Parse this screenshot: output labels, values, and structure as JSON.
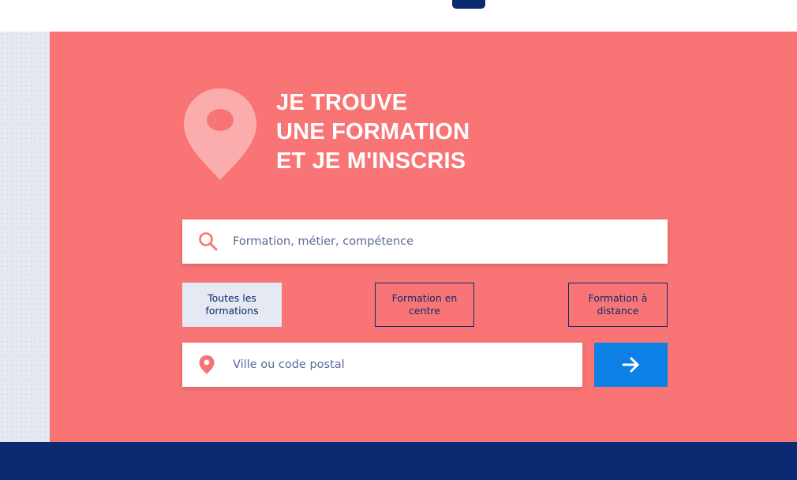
{
  "headline": {
    "line1": "JE TROUVE",
    "line2": "UNE FORMATION",
    "line3": "ET JE M'INSCRIS"
  },
  "search": {
    "placeholder": "Formation, métier, compétence",
    "value": "",
    "icon": "search-icon"
  },
  "filters": [
    {
      "label": "Toutes les formations",
      "active": true
    },
    {
      "label": "Formation en centre",
      "active": false
    },
    {
      "label": "Formation à distance",
      "active": false
    }
  ],
  "location": {
    "placeholder": "Ville ou code postal",
    "value": "",
    "icon": "location-pin-icon"
  },
  "submit": {
    "icon": "arrow-right-icon"
  },
  "colors": {
    "hero_background": "#f97575",
    "accent_blue": "#0d80e6",
    "navy": "#0b2a72",
    "active_filter_bg": "#e4e9f2",
    "pin_light": "#fbadad",
    "icon_coral": "#f47474"
  }
}
